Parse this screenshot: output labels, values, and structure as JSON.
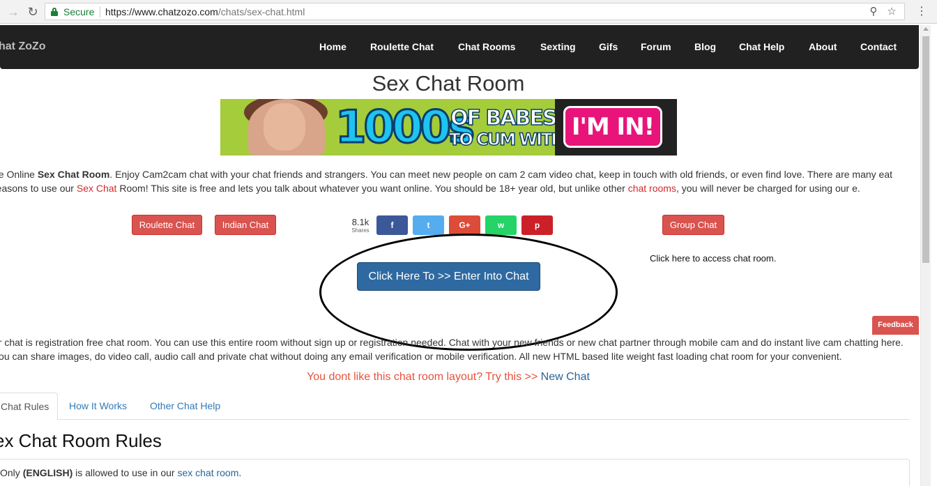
{
  "browser": {
    "secure_label": "Secure",
    "url_host": "https://www.chatzozo.com",
    "url_path": "/chats/sex-chat.html"
  },
  "navbar": {
    "brand": "hat ZoZo",
    "links": [
      "Home",
      "Roulette Chat",
      "Chat Rooms",
      "Sexting",
      "Gifs",
      "Forum",
      "Blog",
      "Chat Help",
      "About",
      "Contact"
    ]
  },
  "page": {
    "title": "Sex Chat Room"
  },
  "banner": {
    "big_text": "1000s",
    "line1": "OF BABES",
    "line2": "TO CUM WITH",
    "cta": "I'M IN!"
  },
  "intro": {
    "t1": "ee Online ",
    "b1": "Sex Chat Room",
    "t2": ". Enjoy Cam2cam chat with your chat friends and strangers. You can meet new people on cam 2 cam video chat, keep in touch with old friends, or even find love. There are many eat reasons to use our ",
    "link1": "Sex Chat",
    "t3": " Room! This site is free and lets you talk about whatever you want online. You should be 18+ year old, but unlike other ",
    "link2": "chat rooms",
    "t4": ", you will never be charged for using our e."
  },
  "buttons": {
    "roulette": "Roulette Chat",
    "indian": "Indian Chat",
    "group": "Group Chat"
  },
  "share": {
    "count": "8.1k",
    "label": "Shares",
    "facebook": "f",
    "twitter": "t",
    "googleplus": "G+",
    "whatsapp": "w",
    "pinterest": "p",
    "colors": {
      "facebook": "#3b5998",
      "twitter": "#55acee",
      "googleplus": "#dd4b39",
      "whatsapp": "#25d366",
      "pinterest": "#cb2027"
    }
  },
  "access_text": "Click here to access chat room.",
  "enter_button": "Click Here To >> Enter Into Chat",
  "feedback": "Feedback",
  "para2": "ur chat is registration free chat room. You can use this entire room without sign up or registration needed. Chat with your new friends or new chat partner through mobile cam and do instant live cam chatting here. You can share images, do video call, audio call and private chat without doing any email verification or mobile verification. All new HTML based lite weight fast loading chat room for your convenient.",
  "layout_line": {
    "text": "You dont like this chat room layout? Try this >> ",
    "link": "New Chat"
  },
  "tabs": [
    "Chat Rules",
    "How It Works",
    "Other Chat Help"
  ],
  "rules": {
    "title": "ex Chat Room Rules",
    "rule1_prefix": "Only ",
    "rule1_bold": "(ENGLISH)",
    "rule1_mid": " is allowed to use in our ",
    "rule1_link": "sex chat room",
    "rule1_end": "."
  }
}
